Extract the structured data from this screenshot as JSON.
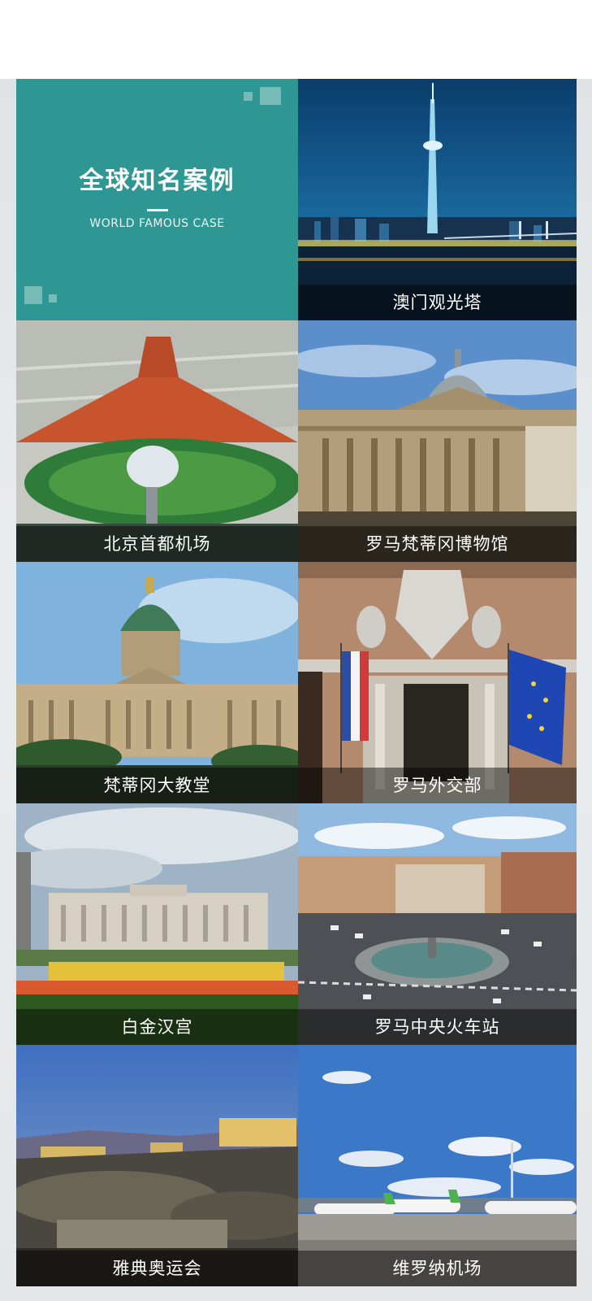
{
  "intro": {
    "title": "全球知名案例",
    "subtitle": "WORLD FAMOUS CASE"
  },
  "cases": [
    {
      "label": "澳门观光塔"
    },
    {
      "label": "北京首都机场"
    },
    {
      "label": "罗马梵蒂冈博物馆"
    },
    {
      "label": "梵蒂冈大教堂"
    },
    {
      "label": "罗马外交部"
    },
    {
      "label": "白金汉宫"
    },
    {
      "label": "罗马中央火车站"
    },
    {
      "label": "雅典奥运会"
    },
    {
      "label": "维罗纳机场"
    }
  ],
  "colors": {
    "intro_bg": "#2f9793",
    "caption_bg": "rgba(0,0,0,0.45)"
  }
}
